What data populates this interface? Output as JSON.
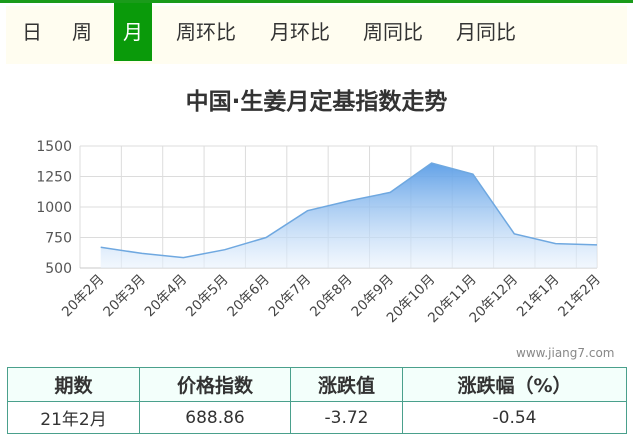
{
  "tabs": [
    {
      "label": "日",
      "active": false
    },
    {
      "label": "周",
      "active": false
    },
    {
      "label": "月",
      "active": true
    },
    {
      "label": "周环比",
      "active": false
    },
    {
      "label": "月环比",
      "active": false
    },
    {
      "label": "周同比",
      "active": false
    },
    {
      "label": "月同比",
      "active": false
    }
  ],
  "colors": {
    "accent": "#0a9a0a",
    "area_top": "#6aa8e8",
    "line": "#6fa8e0",
    "table_border": "#4aa08c"
  },
  "chart_data": {
    "type": "area",
    "title": "中国·生姜月定基指数走势",
    "categories": [
      "20年2月",
      "20年3月",
      "20年4月",
      "20年5月",
      "20年6月",
      "20年7月",
      "20年8月",
      "20年9月",
      "20年10月",
      "20年11月",
      "20年12月",
      "21年1月",
      "21年2月"
    ],
    "values": [
      670,
      620,
      585,
      650,
      750,
      970,
      1050,
      1120,
      1360,
      1270,
      780,
      700,
      689
    ],
    "yticks": [
      1500,
      1250,
      1000,
      750,
      500
    ],
    "ylim": [
      500,
      1500
    ],
    "grid": true
  },
  "watermark": "www.jiang7.com",
  "table": {
    "headers": [
      "期数",
      "价格指数",
      "涨跌值",
      "涨跌幅（%）"
    ],
    "row": [
      "21年2月",
      "688.86",
      "-3.72",
      "-0.54"
    ]
  }
}
